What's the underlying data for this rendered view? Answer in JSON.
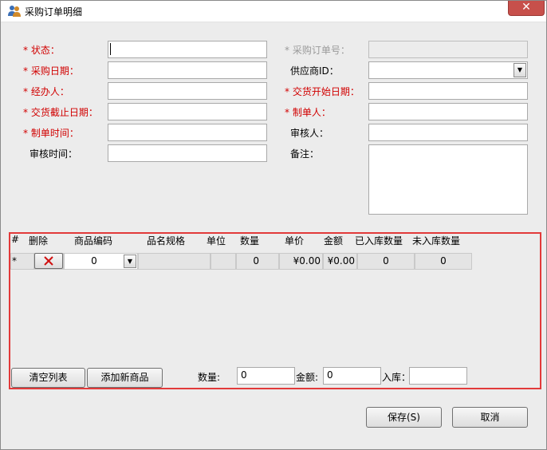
{
  "window": {
    "title": "采购订单明细",
    "close_symbol": "✕"
  },
  "form": {
    "left": [
      {
        "asterisk": "*",
        "label": "状态：",
        "value": ""
      },
      {
        "asterisk": "*",
        "label": "采购日期：",
        "value": ""
      },
      {
        "asterisk": "*",
        "label": "经办人：",
        "value": ""
      },
      {
        "asterisk": "*",
        "label": "交货截止日期：",
        "value": ""
      },
      {
        "asterisk": "*",
        "label": "制单时间：",
        "value": ""
      },
      {
        "asterisk": "",
        "label": "审核时间：",
        "value": ""
      }
    ],
    "right": [
      {
        "asterisk": "*",
        "label": "采购订单号：",
        "value": "",
        "disabled": true
      },
      {
        "asterisk": "",
        "label": "供应商ID：",
        "value": "",
        "type": "combo"
      },
      {
        "asterisk": "*",
        "label": "交货开始日期：",
        "value": ""
      },
      {
        "asterisk": "*",
        "label": "制单人：",
        "value": ""
      },
      {
        "asterisk": "",
        "label": "审核人：",
        "value": ""
      },
      {
        "asterisk": "",
        "label": "备注：",
        "value": ""
      }
    ]
  },
  "grid": {
    "headers": [
      "#",
      "删除",
      "商品编码",
      "品名规格",
      "单位",
      "数量",
      "单价",
      "金额",
      "已入库数量",
      "未入库数量"
    ],
    "row": {
      "marker": "*",
      "delete_icon": "delete-x-icon",
      "code": "0",
      "spec": "",
      "unit": "",
      "qty": "0",
      "price": "¥0.00",
      "amount": "¥0.00",
      "received": "0",
      "pending": "0"
    }
  },
  "footer": {
    "clear_label": "清空列表",
    "add_label": "添加新商品",
    "qty_label": "数量:",
    "qty_value": "0",
    "amount_label": "金额:",
    "amount_value": "0",
    "stock_label": "入库：",
    "stock_value": ""
  },
  "actions": {
    "save_label": "保存(S)",
    "cancel_label": "取消"
  },
  "colors": {
    "required": "#d10000",
    "highlight_border": "#e23a3a",
    "close_bg": "#c7504b"
  }
}
